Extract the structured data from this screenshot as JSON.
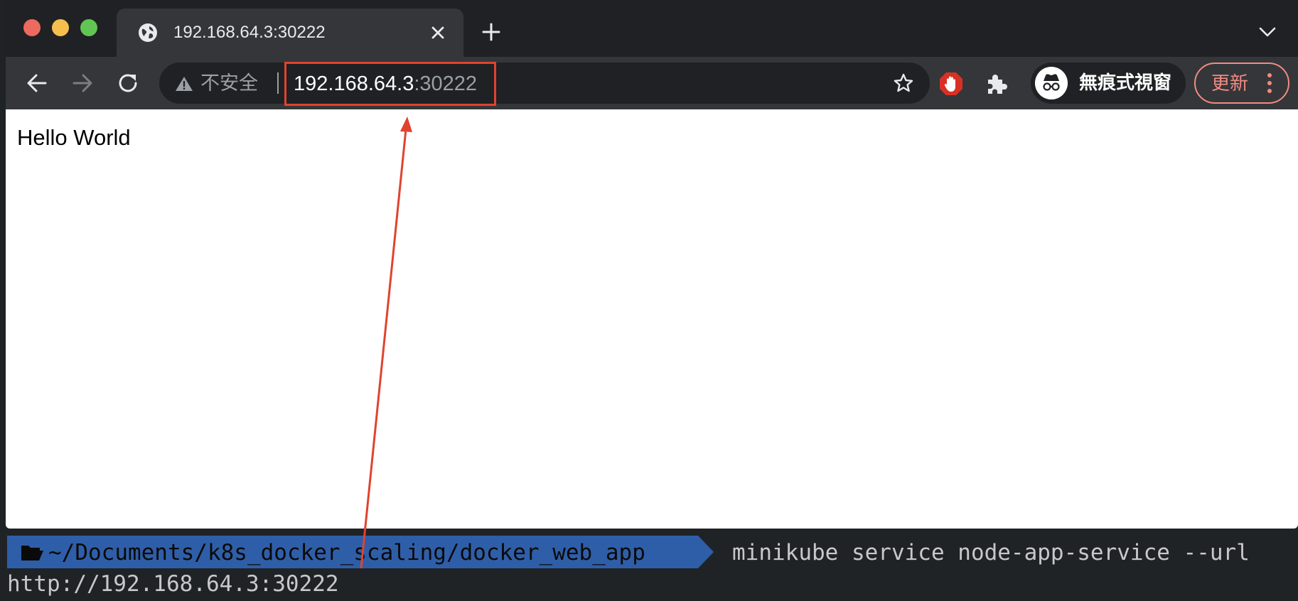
{
  "browser": {
    "tab": {
      "title": "192.168.64.3:30222"
    },
    "toolbar": {
      "security_label": "不安全",
      "url_host": "192.168.64.3",
      "url_port": ":30222"
    },
    "profile": {
      "label": "無痕式視窗"
    },
    "update_button": {
      "label": "更新"
    }
  },
  "page": {
    "text": "Hello World"
  },
  "terminal": {
    "prompt_path": "~/Documents/k8s_docker_scaling/docker_web_app",
    "command": "minikube service node-app-service --url",
    "output": "http://192.168.64.3:30222"
  },
  "colors": {
    "annotation": "#e0432e",
    "prompt_bg": "#2f5ea8",
    "update_accent": "#f28b82"
  },
  "icons": [
    "globe-icon",
    "close-icon",
    "plus-icon",
    "chevron-down-icon",
    "back-icon",
    "forward-icon",
    "reload-icon",
    "warning-icon",
    "star-icon",
    "adblock-icon",
    "puzzle-icon",
    "incognito-icon",
    "more-icon",
    "folder-icon"
  ]
}
